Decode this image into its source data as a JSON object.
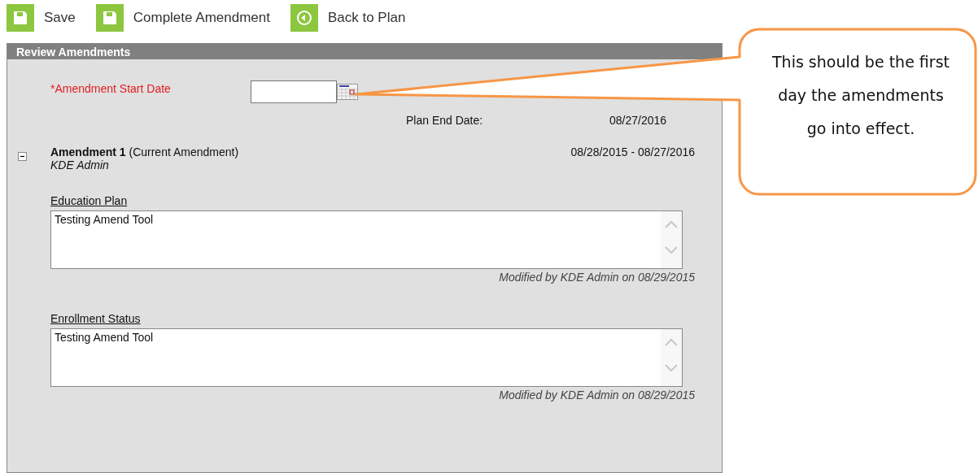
{
  "toolbar": [
    {
      "kind": "save",
      "label": "Save"
    },
    {
      "kind": "save",
      "label": "Complete Amendment"
    },
    {
      "kind": "back",
      "label": "Back to Plan"
    }
  ],
  "panel": {
    "title": "Review Amendments",
    "start_date": {
      "label": "*Amendment Start Date",
      "required": true
    },
    "plan_end": {
      "label": "Plan End Date:",
      "value": "08/27/2016"
    },
    "amendment": {
      "expanded": true,
      "title": "**Amendment 1** (Current Amendment)",
      "author": "KDE Admin",
      "dates": "08/28/2015 - 08/27/2016",
      "sections": [
        {
          "heading": "Education Plan",
          "text": "Testing Amend Tool",
          "modified": "Modified by KDE Admin on 08/29/2015"
        },
        {
          "heading": "Enrollment Status",
          "text": "Testing Amend Tool",
          "modified": "Modified by KDE Admin on 08/29/2015"
        }
      ]
    }
  },
  "callout": {
    "text": "This should be the first day the amendments go into effect."
  }
}
